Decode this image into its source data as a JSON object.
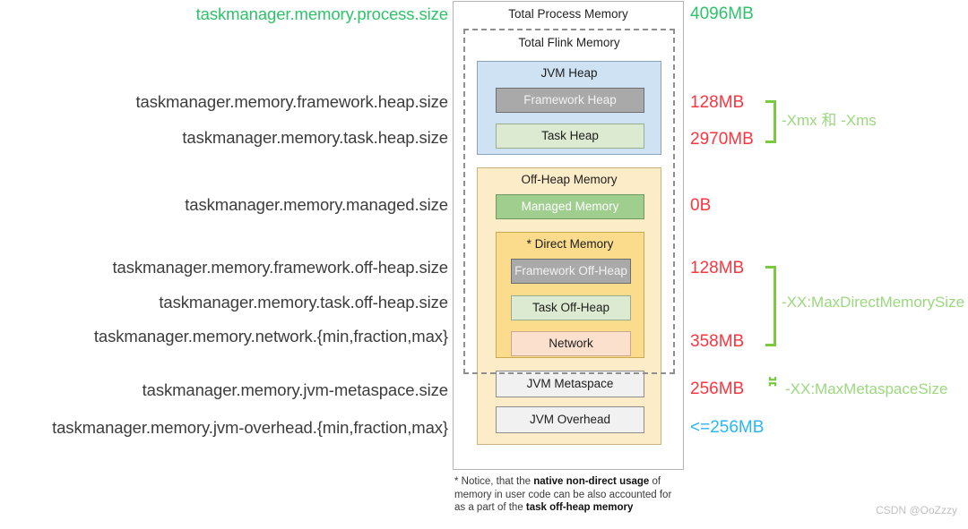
{
  "diagram": {
    "outer_title": "Total Process Memory",
    "flink_title": "Total Flink Memory",
    "jvm_heap": {
      "title": "JVM Heap",
      "children": [
        {
          "label": "Framework Heap"
        },
        {
          "label": "Task Heap"
        }
      ]
    },
    "off_heap": {
      "title": "Off-Heap Memory",
      "managed": "Managed Memory",
      "direct": {
        "title": "* Direct Memory",
        "children": [
          {
            "label": "Framework Off-Heap"
          },
          {
            "label": "Task Off-Heap"
          },
          {
            "label": "Network"
          }
        ]
      },
      "metaspace": "JVM Metaspace",
      "overhead": "JVM Overhead"
    }
  },
  "footnote": {
    "prefix": "* Notice, that the ",
    "bold1": "native non-direct usage",
    "mid": " of memory in user code can be also accounted for as a part of the ",
    "bold2": "task off-heap memory"
  },
  "config_keys": [
    {
      "text": "taskmanager.memory.process.size",
      "color": "green"
    },
    {
      "text": "taskmanager.memory.framework.heap.size",
      "color": "dark"
    },
    {
      "text": "taskmanager.memory.task.heap.size",
      "color": "dark"
    },
    {
      "text": "taskmanager.memory.managed.size",
      "color": "dark"
    },
    {
      "text": "taskmanager.memory.framework.off-heap.size",
      "color": "dark"
    },
    {
      "text": "taskmanager.memory.task.off-heap.size",
      "color": "dark"
    },
    {
      "text": "taskmanager.memory.network.{min,fraction,max}",
      "color": "dark"
    },
    {
      "text": "taskmanager.memory.jvm-metaspace.size",
      "color": "dark"
    },
    {
      "text": "taskmanager.memory.jvm-overhead.{min,fraction,max}",
      "color": "dark"
    }
  ],
  "values": [
    {
      "text": "4096MB",
      "color": "green"
    },
    {
      "text": "128MB",
      "color": "red"
    },
    {
      "text": "2970MB",
      "color": "red"
    },
    {
      "text": "0B",
      "color": "red"
    },
    {
      "text": "128MB",
      "color": "red"
    },
    {
      "text": "358MB",
      "color": "red"
    },
    {
      "text": "256MB",
      "color": "red"
    },
    {
      "text": "<=256MB",
      "color": "cyan"
    }
  ],
  "jvm_flags": [
    {
      "text": "-Xmx 和 -Xms"
    },
    {
      "text": "-XX:MaxDirectMemorySize"
    },
    {
      "text": "-XX:MaxMetaspaceSize"
    }
  ],
  "watermark": "CSDN @OoZzzy",
  "colors": {
    "green": "#2ec36a",
    "red": "#fb3640",
    "cyan": "#29b6f6",
    "bracket": "#7ac943",
    "flag": "#9bd87e",
    "jvm_heap_bg": "#cfe2f3",
    "off_heap_bg": "#fdecc8",
    "direct_bg": "#fbdc8c",
    "gray_box": "#a9a9a9",
    "light_green_box": "#dcead2",
    "managed_green": "#9fce8f",
    "network_peach": "#fbe0cd",
    "plain_box": "#f1f1f1"
  }
}
